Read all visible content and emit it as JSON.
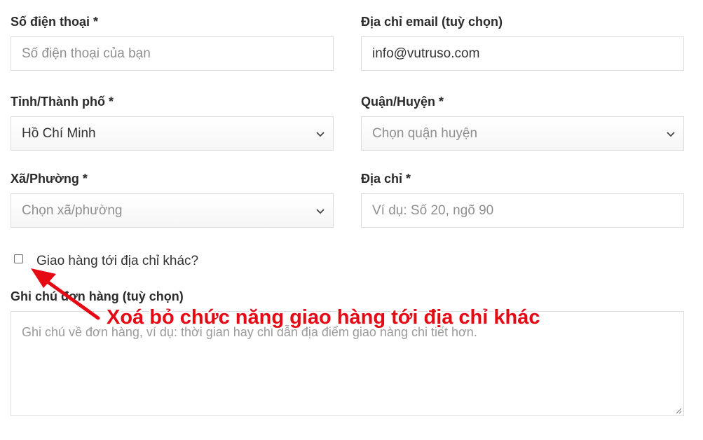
{
  "phone": {
    "label": "Số điện thoại *",
    "placeholder": "Số điện thoại của bạn"
  },
  "email": {
    "label": "Địa chỉ email (tuỳ chọn)",
    "value": "info@vutruso.com"
  },
  "province": {
    "label": "Tỉnh/Thành phố *",
    "selected": "Hồ Chí Minh"
  },
  "district": {
    "label": "Quận/Huyện *",
    "placeholder": "Chọn quận huyện"
  },
  "ward": {
    "label": "Xã/Phường *",
    "placeholder": "Chọn xã/phường"
  },
  "address": {
    "label": "Địa chỉ *",
    "placeholder": "Ví dụ: Số 20, ngõ 90"
  },
  "ship_different": {
    "label": "Giao hàng tới địa chỉ khác?",
    "checked": false
  },
  "order_notes": {
    "label": "Ghi chú đơn hàng (tuỳ chọn)",
    "placeholder": "Ghi chú về đơn hàng, ví dụ: thời gian hay chỉ dẫn địa điểm giao hàng chi tiết hơn."
  },
  "annotation": {
    "text": "Xoá bỏ chức năng giao hàng tới địa chỉ khác",
    "color": "#e50914"
  }
}
